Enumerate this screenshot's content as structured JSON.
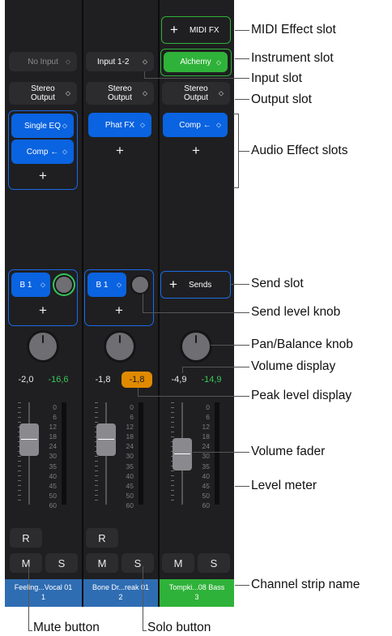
{
  "strips": [
    {
      "midi_fx": "",
      "instrument": "",
      "input": "No Input",
      "output": [
        "Stereo",
        "Output"
      ],
      "effects": [
        "Single EQ",
        "Comp ←"
      ],
      "send": "B 1",
      "pan": "-2,0",
      "peak": "-16,6",
      "record": "R",
      "mute": "M",
      "solo": "S",
      "name": [
        "Feeling...Vocal 01",
        "1"
      ],
      "name_color": "#2f6db3"
    },
    {
      "midi_fx": "",
      "instrument": "",
      "input": "Input 1-2",
      "output": [
        "Stereo",
        "Output"
      ],
      "effects": [
        "Phat FX"
      ],
      "send": "B 1",
      "pan": "-1,8",
      "peak": "-1,8",
      "record": "R",
      "mute": "M",
      "solo": "S",
      "name": [
        "Bone Dr...reak 01",
        "2"
      ],
      "name_color": "#2f6db3"
    },
    {
      "midi_fx": "MIDI FX",
      "instrument": "Alchemy",
      "input": "",
      "output": [
        "Stereo",
        "Output"
      ],
      "effects": [
        "Comp ←"
      ],
      "send": "Sends",
      "pan": "-4,9",
      "peak": "-14,9",
      "record": "",
      "mute": "M",
      "solo": "S",
      "name": [
        "Tompki...08 Bass",
        "3"
      ],
      "name_color": "#2fb239"
    }
  ],
  "meter_scale": [
    "0",
    "6",
    "12",
    "18",
    "24",
    "30",
    "35",
    "40",
    "45",
    "50",
    "60"
  ],
  "callouts": {
    "midi_effect_slot": "MIDI Effect slot",
    "instrument_slot": "Instrument slot",
    "input_slot": "Input slot",
    "output_slot": "Output slot",
    "audio_effect_slots": "Audio Effect slots",
    "send_slot": "Send slot",
    "send_level_knob": "Send level knob",
    "pan_balance_knob": "Pan/Balance knob",
    "volume_display": "Volume display",
    "peak_level_display": "Peak level display",
    "volume_fader": "Volume fader",
    "level_meter": "Level meter",
    "channel_strip_name": "Channel strip name",
    "mute_button": "Mute button",
    "solo_button": "Solo button"
  },
  "colors": {
    "mixer_bg": "#1f1f21",
    "slot_blue": "#0a63e0",
    "instrument_green": "#2fb239",
    "peak_orange": "#e08a00",
    "level_green": "#35c759"
  }
}
